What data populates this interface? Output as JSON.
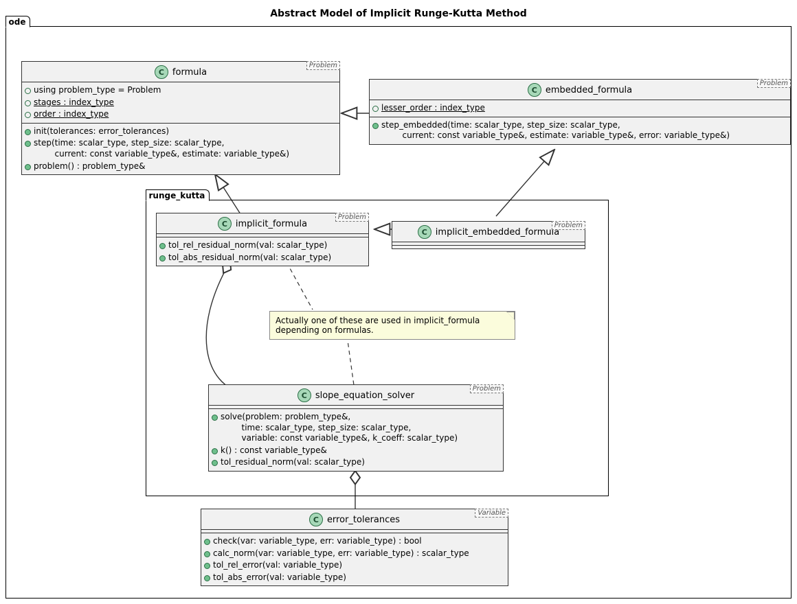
{
  "title": "Abstract Model of Implicit Runge-Kutta Method",
  "packages": {
    "outer": "ode",
    "inner": "runge_kutta"
  },
  "note": "Actually one of these are used in implicit_formula depending on formulas.",
  "classes": {
    "formula": {
      "name": "formula",
      "stereo": "Problem",
      "attrs": [
        "using problem_type = Problem",
        "stages : index_type",
        "order : index_type"
      ],
      "ops": [
        "init(tolerances: error_tolerances)",
        "step(time: scalar_type, step_size: scalar_type,\n        current: const variable_type&, estimate: variable_type&)",
        "problem() : problem_type&"
      ]
    },
    "embedded_formula": {
      "name": "embedded_formula",
      "stereo": "Problem",
      "attrs": [
        "lesser_order : index_type"
      ],
      "ops": [
        "step_embedded(time: scalar_type, step_size: scalar_type,\n        current: const variable_type&, estimate: variable_type&, error: variable_type&)"
      ]
    },
    "implicit_formula": {
      "name": "implicit_formula",
      "stereo": "Problem",
      "ops": [
        "tol_rel_residual_norm(val: scalar_type)",
        "tol_abs_residual_norm(val: scalar_type)"
      ]
    },
    "implicit_embedded_formula": {
      "name": "implicit_embedded_formula",
      "stereo": "Problem"
    },
    "slope_equation_solver": {
      "name": "slope_equation_solver",
      "stereo": "Problem",
      "ops": [
        "solve(problem: problem_type&,\n        time: scalar_type, step_size: scalar_type,\n        variable: const variable_type&, k_coeff: scalar_type)",
        "k() : const variable_type&",
        "tol_residual_norm(val: scalar_type)"
      ]
    },
    "error_tolerances": {
      "name": "error_tolerances",
      "stereo": "Variable",
      "ops": [
        "check(var: variable_type, err: variable_type) : bool",
        "calc_norm(var: variable_type, err: variable_type) : scalar_type",
        "tol_rel_error(val: variable_type)",
        "tol_abs_error(val: variable_type)"
      ]
    }
  }
}
